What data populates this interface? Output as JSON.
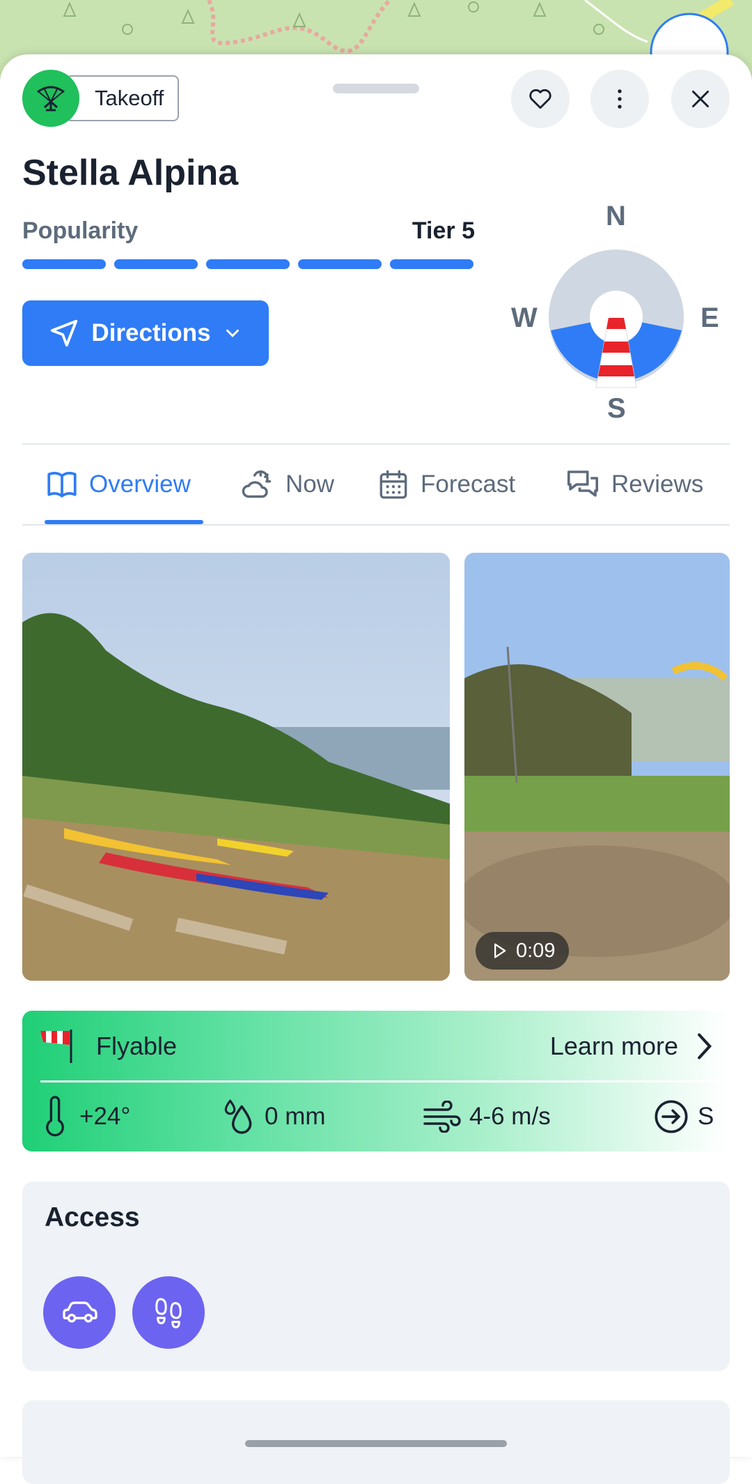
{
  "header": {
    "type_label": "Takeoff",
    "title": "Stella Alpina"
  },
  "popularity": {
    "label": "Popularity",
    "tier": "Tier 5",
    "level": 5,
    "max": 5
  },
  "directions_label": "Directions",
  "compass": {
    "n": "N",
    "e": "E",
    "s": "S",
    "w": "W",
    "favorable_wind_from": "S"
  },
  "tabs": [
    {
      "label": "Overview",
      "icon": "book-icon",
      "active": true
    },
    {
      "label": "Now",
      "icon": "sun-cloud-icon",
      "active": false
    },
    {
      "label": "Forecast",
      "icon": "calendar-icon",
      "active": false
    },
    {
      "label": "Reviews",
      "icon": "chat-icon",
      "active": false
    }
  ],
  "media": {
    "video_duration": "0:09"
  },
  "conditions": {
    "status": "Flyable",
    "learn_more": "Learn more",
    "temperature": "+24°",
    "precipitation": "0 mm",
    "wind": "4-6 m/s",
    "direction": "S"
  },
  "access": {
    "title": "Access",
    "modes": [
      "car-icon",
      "footprints-icon"
    ]
  },
  "colors": {
    "accent": "#2f7cf6",
    "takeoff_green": "#20c05c",
    "flyable_green": "#1fcf76",
    "access_purple": "#6c63f0"
  }
}
